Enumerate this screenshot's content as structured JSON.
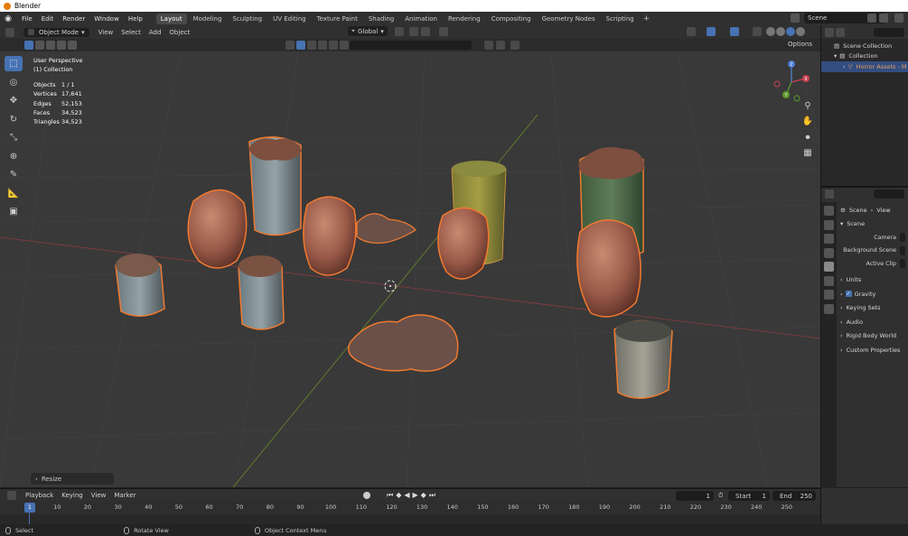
{
  "window": {
    "title": "Blender"
  },
  "menubar": {
    "menus": [
      "File",
      "Edit",
      "Render",
      "Window",
      "Help"
    ],
    "workspaces": [
      "Layout",
      "Modeling",
      "Sculpting",
      "UV Editing",
      "Texture Paint",
      "Shading",
      "Animation",
      "Rendering",
      "Compositing",
      "Geometry Nodes",
      "Scripting"
    ],
    "active_workspace": "Layout",
    "add_tab": "+",
    "scene": "Scene"
  },
  "viewport_header": {
    "mode": "Object Mode",
    "menus": [
      "View",
      "Select",
      "Add",
      "Object"
    ],
    "orientation": "Global",
    "options": "Options"
  },
  "viewport": {
    "perspective": "User Perspective",
    "collection": "(1) Collection",
    "stats": [
      {
        "label": "Objects",
        "value": "1 / 1"
      },
      {
        "label": "Vertices",
        "value": "17,641"
      },
      {
        "label": "Edges",
        "value": "52,153"
      },
      {
        "label": "Faces",
        "value": "34,523"
      },
      {
        "label": "Triangles",
        "value": "34,523"
      }
    ],
    "last_operator": "Resize",
    "gizmo": {
      "x": "X",
      "y": "Y",
      "z": "Z"
    }
  },
  "outliner": {
    "root": "Scene Collection",
    "collection": "Collection",
    "object": "Horror Assets - M"
  },
  "properties": {
    "breadcrumb_scene": "Scene",
    "breadcrumb_extra": "View",
    "panel": "Scene",
    "fields": [
      "Camera",
      "Background Scene",
      "Active Clip"
    ],
    "sections": [
      "Units",
      "Gravity",
      "Keying Sets",
      "Audio",
      "Rigid Body World",
      "Custom Properties"
    ]
  },
  "timeline": {
    "menus": [
      "Playback",
      "Keying",
      "View",
      "Marker"
    ],
    "current_frame": "1",
    "start_label": "Start",
    "start": "1",
    "end_label": "End",
    "end": "250",
    "ticks": [
      "1",
      "10",
      "20",
      "30",
      "40",
      "50",
      "60",
      "70",
      "80",
      "90",
      "100",
      "110",
      "120",
      "130",
      "140",
      "150",
      "160",
      "170",
      "180",
      "190",
      "200",
      "210",
      "220",
      "230",
      "240",
      "250"
    ]
  },
  "statusbar": {
    "left": "Select",
    "middle": "Rotate View",
    "right": "Object Context Menu"
  },
  "colors": {
    "accent": "#4772b3",
    "selection_outline": "#e8752b",
    "background": "#393939"
  }
}
